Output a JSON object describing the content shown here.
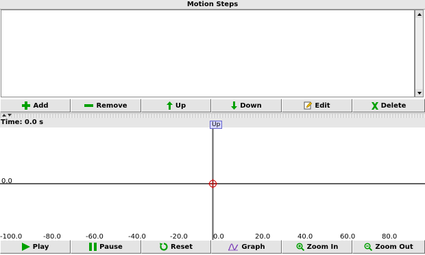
{
  "motion_steps": {
    "title": "Motion Steps",
    "buttons": [
      {
        "id": "add",
        "label": "Add",
        "icon": "plus-icon"
      },
      {
        "id": "remove",
        "label": "Remove",
        "icon": "minus-icon"
      },
      {
        "id": "up",
        "label": "Up",
        "icon": "arrow-up-icon"
      },
      {
        "id": "down",
        "label": "Down",
        "icon": "arrow-down-icon"
      },
      {
        "id": "edit",
        "label": "Edit",
        "icon": "edit-icon"
      },
      {
        "id": "delete",
        "label": "Delete",
        "icon": "x-icon"
      }
    ]
  },
  "timeline": {
    "time_label": "Time: 0.0 s",
    "y_label": "0.0",
    "marker_label": "Up",
    "x_ticks": [
      "-100.0",
      "-80.0",
      "-60.0",
      "-40.0",
      "-20.0",
      "0.0",
      "20.0",
      "40.0",
      "60.0",
      "80.0"
    ],
    "controls": [
      {
        "id": "play",
        "label": "Play",
        "icon": "play-icon"
      },
      {
        "id": "pause",
        "label": "Pause",
        "icon": "pause-icon"
      },
      {
        "id": "reset",
        "label": "Reset",
        "icon": "reset-icon"
      },
      {
        "id": "graph",
        "label": "Graph",
        "icon": "graph-icon"
      },
      {
        "id": "zoom_in",
        "label": "Zoom In",
        "icon": "zoom-in-icon"
      },
      {
        "id": "zoom_out",
        "label": "Zoom Out",
        "icon": "zoom-out-icon"
      }
    ]
  },
  "colors": {
    "green": "#00a000",
    "plot_axis": "#606060",
    "cursor": "#cc0000"
  }
}
